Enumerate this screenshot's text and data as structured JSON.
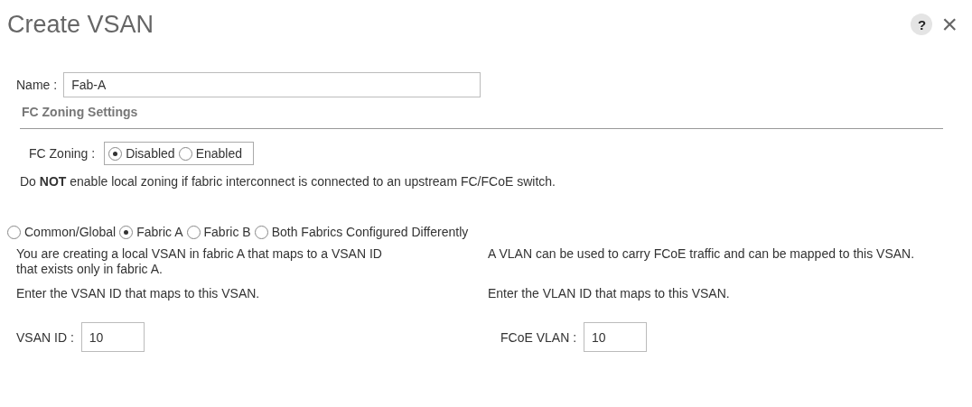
{
  "dialog": {
    "title": "Create VSAN",
    "help_button": "?",
    "close_button": "×"
  },
  "name_field": {
    "label": "Name :",
    "value": "Fab-A"
  },
  "section_heading": "FC Zoning Settings",
  "fc_zoning": {
    "label": "FC Zoning :",
    "options": [
      {
        "label": "Disabled",
        "selected": true
      },
      {
        "label": "Enabled",
        "selected": false
      }
    ]
  },
  "warning": "Do **NOT** enable local zoning if fabric interconnect is connected to an upstream FC/FCoE switch.",
  "fabric_options": [
    {
      "label": "Common/Global",
      "selected": false
    },
    {
      "label": "Fabric A",
      "selected": true
    },
    {
      "label": "Fabric B",
      "selected": false
    },
    {
      "label": "Both Fabrics Configured Differently",
      "selected": false
    }
  ],
  "columns": [
    {
      "description": "You are creating a local VSAN in fabric A that maps to a VSAN ID that exists only in fabric A.",
      "hint": "Enter the VSAN ID that maps to this VSAN.",
      "field_label": "VSAN ID :",
      "field_value": "10"
    },
    {
      "description": "A VLAN can be used to carry FCoE traffic and can be mapped to this VSAN.",
      "hint": "Enter the VLAN ID that maps to this VSAN.",
      "field_label": "FCoE VLAN :",
      "field_value": "10"
    }
  ]
}
